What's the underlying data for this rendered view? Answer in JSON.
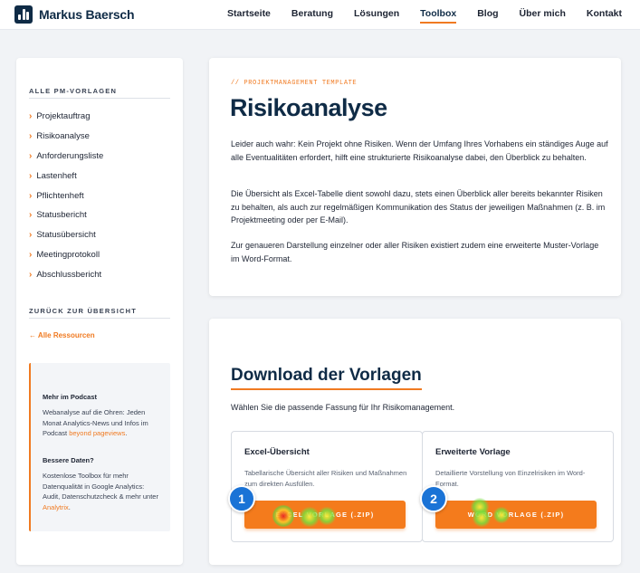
{
  "header": {
    "brand": "Markus Baersch",
    "nav": [
      "Startseite",
      "Beratung",
      "Lösungen",
      "Toolbox",
      "Blog",
      "Über mich",
      "Kontakt"
    ],
    "active_nav": "Toolbox"
  },
  "sidebar": {
    "heading": "ALLE PM-VORLAGEN",
    "items": [
      {
        "label": "Projektauftrag"
      },
      {
        "label": "Risikoanalyse"
      },
      {
        "label": "Anforderungsliste"
      },
      {
        "label": "Lastenheft"
      },
      {
        "label": "Pflichtenheft"
      },
      {
        "label": "Statusbericht"
      },
      {
        "label": "Statusübersicht"
      },
      {
        "label": "Meetingprotokoll"
      },
      {
        "label": "Abschlussbericht"
      }
    ],
    "back_heading": "ZURÜCK ZUR ÜBERSICHT",
    "back_link": "← Alle Ressourcen",
    "podcast": {
      "title": "Mehr im Podcast",
      "text": "Webanalyse auf die Ohren: Jeden Monat Analytics-News und Infos im Podcast ",
      "link": "beyond pageviews",
      "after": "."
    },
    "data": {
      "title": "Bessere Daten?",
      "text": "Kostenlose Toolbox für mehr Datenqualität in Google Analytics: Audit, Datenschutzcheck & mehr unter ",
      "link": "Analytrix",
      "after": "."
    }
  },
  "main": {
    "eyebrow": "// PROJEKTMANAGEMENT TEMPLATE",
    "title": "Risikoanalyse",
    "paragraphs": [
      "Leider auch wahr: Kein Projekt ohne Risiken. Wenn der Umfang Ihres Vorhabens ein ständiges Auge auf alle Eventualitäten erfordert, hilft eine strukturierte Risikoanalyse dabei, den Überblick zu behalten.",
      "Die Übersicht als Excel-Tabelle dient sowohl dazu, stets einen Überblick aller bereits bekannter Risiken zu behalten, als auch zur regelmäßigen Kommunikation des Status der jeweiligen Maßnahmen (z. B. im Projektmeeting oder per E-Mail).",
      "Zur genaueren Darstellung einzelner oder aller Risiken existiert zudem eine erweiterte Muster-Vorlage im Word-Format."
    ]
  },
  "downloads": {
    "title": "Download der Vorlagen",
    "subtitle": "Wählen Sie die passende Fassung für Ihr Risikomanagement.",
    "cards": [
      {
        "title": "Excel-Übersicht",
        "desc": "Tabellarische Übersicht aller Risiken und Maßnahmen zum direkten Ausfüllen.",
        "button": "EXCEL VORLAGE (.ZIP)",
        "marker": "1"
      },
      {
        "title": "Erweiterte Vorlage",
        "desc": "Detaillierte Vorstellung von Einzelrisiken im Word-Format.",
        "button": "WORD VORLAGE (.ZIP)",
        "marker": "2"
      }
    ]
  },
  "colors": {
    "accent": "#f07a21",
    "brand": "#0f2b46",
    "marker": "#1a73d6"
  }
}
